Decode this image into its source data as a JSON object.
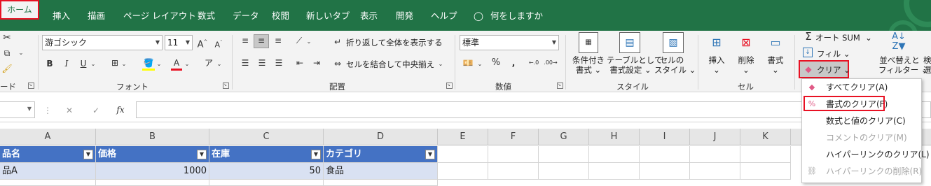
{
  "tabs": [
    "ホーム",
    "挿入",
    "描画",
    "ページ レイアウト",
    "数式",
    "データ",
    "校閲",
    "新しいタブ",
    "表示",
    "開発",
    "ヘルプ"
  ],
  "tell_me": "何をしますか",
  "clipboard": {
    "label": "ード"
  },
  "font": {
    "name": "游ゴシック",
    "size": "11",
    "bold": "B",
    "italic": "I",
    "underline": "U",
    "grow": "A",
    "shrink": "A",
    "fontcolor": "A",
    "group_label": "フォント"
  },
  "alignment": {
    "wrap": "折り返して全体を表示する",
    "merge": "セルを結合して中央揃え",
    "group_label": "配置"
  },
  "number": {
    "format": "標準",
    "percent": "%",
    "group_label": "数値"
  },
  "styles": {
    "conditional": [
      "条件付き",
      "書式"
    ],
    "table": [
      "テーブルとして",
      "書式設定"
    ],
    "cell": [
      "セルの",
      "スタイル"
    ],
    "group_label": "スタイル"
  },
  "cells": {
    "insert": "挿入",
    "delete": "削除",
    "format": "書式",
    "group_label": "セル"
  },
  "editing": {
    "autosum": "オート SUM",
    "fill": "フィル",
    "clear": "クリア",
    "sort": [
      "並べ替えと",
      "フィルター"
    ],
    "find": [
      "検",
      "選"
    ]
  },
  "formula_bar": {
    "cancel": "✕",
    "enter": "✓",
    "fx": "fx",
    "value": ""
  },
  "columns": [
    "A",
    "B",
    "C",
    "D",
    "E",
    "F",
    "G",
    "H",
    "I",
    "J",
    "K"
  ],
  "table": {
    "headers": [
      "品名",
      "価格",
      "在庫",
      "カテゴリ"
    ],
    "rows": [
      [
        "品A",
        "1000",
        "50",
        "食品"
      ]
    ]
  },
  "clear_menu": {
    "items": [
      {
        "label": "すべてクリア(A)",
        "enabled": true
      },
      {
        "label": "書式のクリア(F)",
        "enabled": true
      },
      {
        "label": "数式と値のクリア(C)",
        "enabled": true
      },
      {
        "label": "コメントのクリア(M)",
        "enabled": false
      },
      {
        "label": "ハイパーリンクのクリア(L)",
        "enabled": true
      },
      {
        "label": "ハイパーリンクの削除(R)",
        "enabled": false
      }
    ]
  },
  "colors": {
    "accent": "#217346",
    "highlight": "#e81123",
    "table_header": "#4472c4",
    "table_row": "#d9e1f2"
  }
}
